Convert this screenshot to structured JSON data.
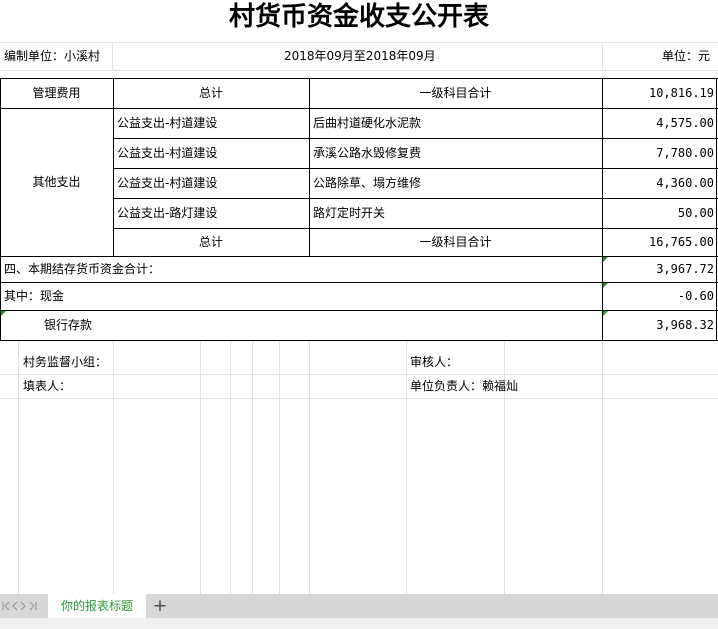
{
  "title": "村货币资金收支公开表",
  "header": {
    "unit_label": "编制单位：小溪村",
    "period": "2018年09月至2018年09月",
    "currency": "单位：元"
  },
  "management": {
    "category": "管理费用",
    "total_label": "总计",
    "subject_label": "一级科目合计",
    "amount": "10,816.19"
  },
  "other": {
    "category": "其他支出",
    "rows": [
      {
        "type": "公益支出-村道建设",
        "desc": "后曲村道硬化水泥款",
        "amount": "4,575.00"
      },
      {
        "type": "公益支出-村道建设",
        "desc": "承溪公路水毁修复费",
        "amount": "7,780.00"
      },
      {
        "type": "公益支出-村道建设",
        "desc": "公路除草、塌方维修",
        "amount": "4,360.00"
      },
      {
        "type": "公益支出-路灯建设",
        "desc": "路灯定时开关",
        "amount": "50.00"
      }
    ],
    "total_label": "总计",
    "subject_label": "一级科目合计",
    "total_amount": "16,765.00"
  },
  "balance": {
    "label": "四、本期结存货币资金合计：",
    "amount": "3,967.72",
    "cash_label": "其中：现金",
    "cash_amount": "-0.60",
    "bank_label": "银行存款",
    "bank_amount": "3,968.32"
  },
  "footer": {
    "supervision": "村务监督小组：",
    "reviewer": "审核人：",
    "preparer": "填表人：",
    "responsible": "单位负责人：赖福灿"
  },
  "tabs": {
    "active": "你的报表标题",
    "add": "+"
  },
  "nav_icons": [
    "first-sheet-icon",
    "prev-sheet-icon",
    "next-sheet-icon",
    "last-sheet-icon"
  ],
  "colors": {
    "accent": "#2e9a3a",
    "grid": "#e2e2e2",
    "tabbar": "#d7d7d7"
  }
}
